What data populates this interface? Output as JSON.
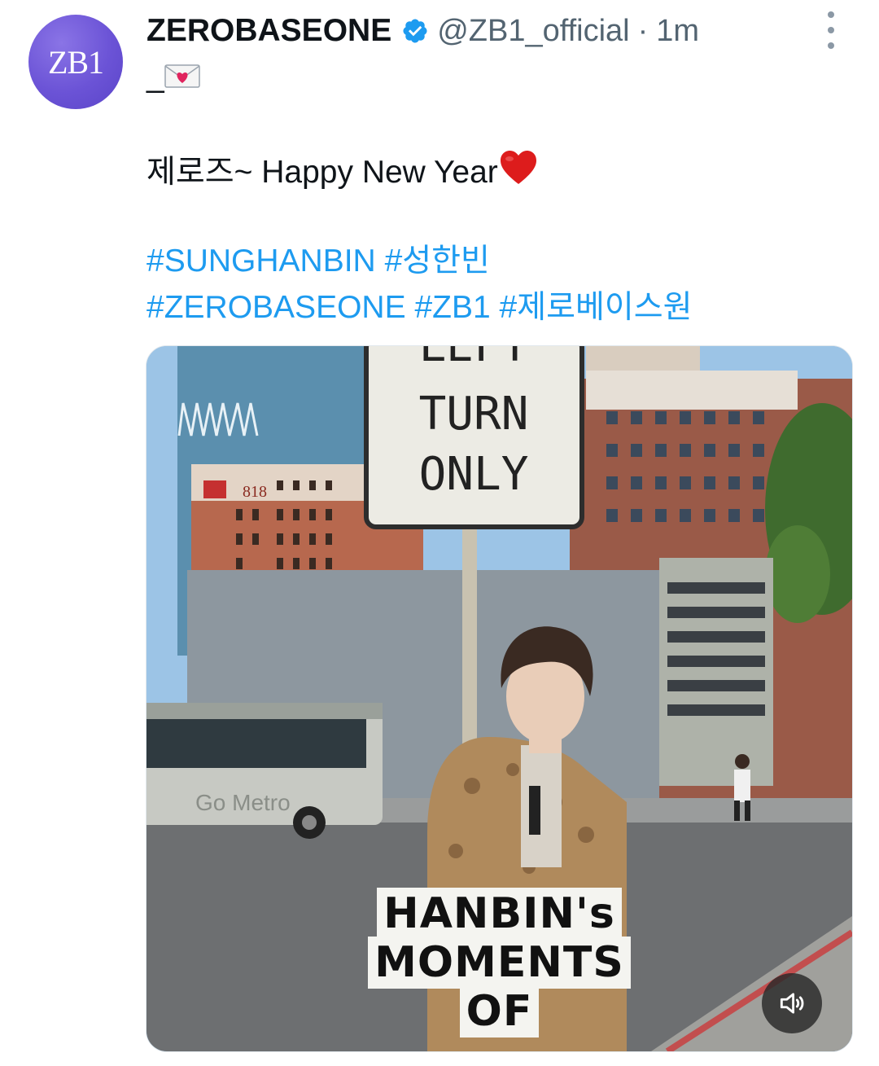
{
  "author": {
    "display_name": "ZEROBASEONE",
    "handle": "@ZB1_official",
    "separator": "·",
    "timestamp": "1m",
    "avatar_text": "ZB1",
    "verified": true
  },
  "tweet": {
    "line1": "_",
    "line2": "제로즈~ Happy New Year",
    "hashtags_row1": [
      "#SUNGHANBIN",
      "#성한빈"
    ],
    "hashtags_row2": [
      "#ZEROBASEONE",
      "#ZB1",
      "#제로베이스원"
    ]
  },
  "media": {
    "sign_lines": [
      "LEFT",
      "TURN",
      "ONLY"
    ],
    "building_number": "818",
    "bus_text": "Go Metro",
    "caption_lines": [
      "HANBIN's",
      "MOMENTS",
      "OF"
    ]
  },
  "icons": {
    "verified": "verified-badge-icon",
    "more": "more-vertical-icon",
    "envelope": "love-letter-icon",
    "heart": "red-heart-icon",
    "volume": "volume-muted-icon"
  },
  "colors": {
    "link": "#1d9bf0",
    "secondary_text": "#536471",
    "avatar": "#6b53d6"
  }
}
